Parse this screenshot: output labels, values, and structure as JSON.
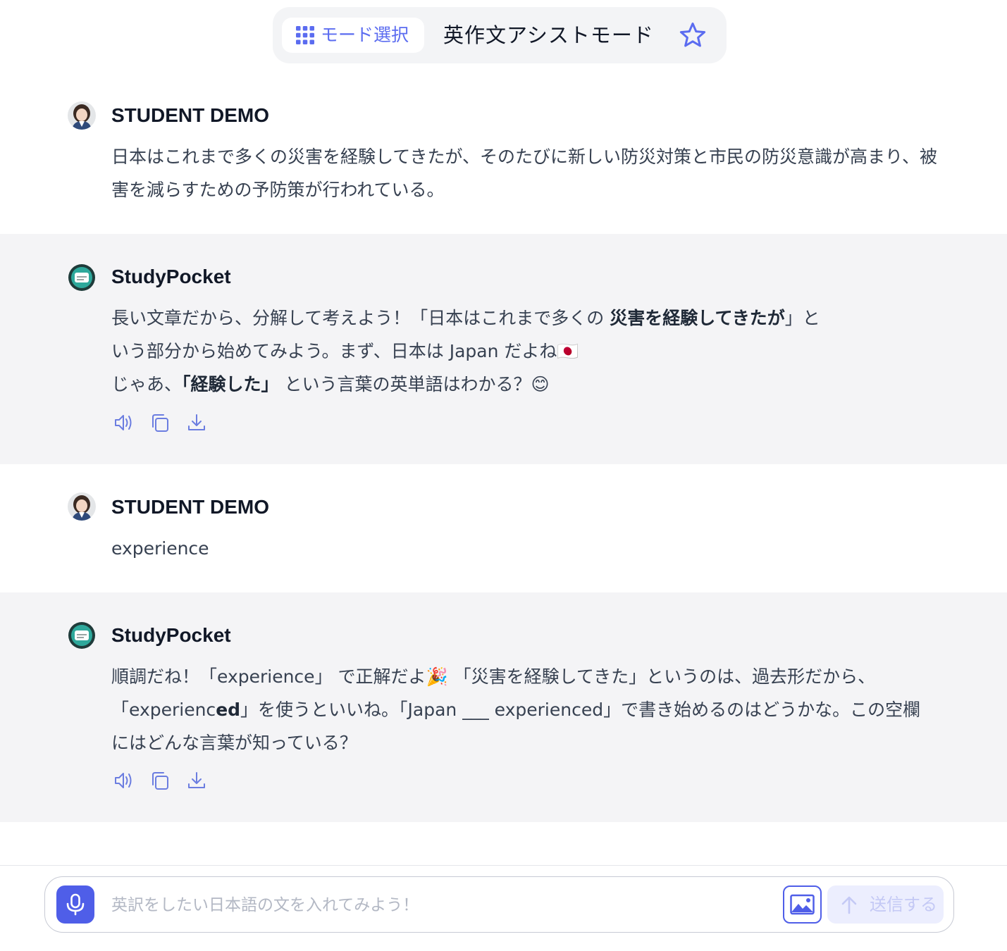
{
  "header": {
    "mode_select_label": "モード選択",
    "mode_title": "英作文アシストモード"
  },
  "messages": [
    {
      "sender": "STUDENT DEMO",
      "text": "日本はこれまで多くの災害を経験してきたが、そのたびに新しい防災対策と市民の防災意識が高まり、被害を減らすための予防策が行われている。"
    },
    {
      "sender": "StudyPocket",
      "parts": [
        "長い文章だから、分解して考えよう！「日本はこれまで多くの ",
        "災害を経験してきたが",
        "」という部分から始めてみよう。まず、日本は Japan だよね🇯🇵",
        "じゃあ、",
        "「経験した」",
        " という言葉の英単語はわかる？😊"
      ]
    },
    {
      "sender": "STUDENT DEMO",
      "text": "experience"
    },
    {
      "sender": "StudyPocket",
      "parts": [
        "順調だね！「experience」 で正解だよ🎉 「災害を経験してきた」というのは、過去形だから、「experienc",
        "ed",
        "」を使うといいね。「Japan ___ experienced」で書き始めるのはどうかな。この空欄にはどんな言葉が知っている？"
      ]
    }
  ],
  "footer": {
    "input_placeholder": "英訳をしたい日本語の文を入れてみよう！",
    "send_label": "送信する"
  },
  "icons": {
    "mode_select": "grid-icon",
    "favorite": "star-icon",
    "speak": "speaker-icon",
    "copy": "copy-icon",
    "download": "download-icon",
    "mic": "microphone-icon",
    "image": "image-icon",
    "send": "arrow-up-icon"
  },
  "colors": {
    "accent": "#4f5ee8",
    "bot_bg": "#f4f4f6",
    "send_disabled_bg": "#eceefe"
  }
}
